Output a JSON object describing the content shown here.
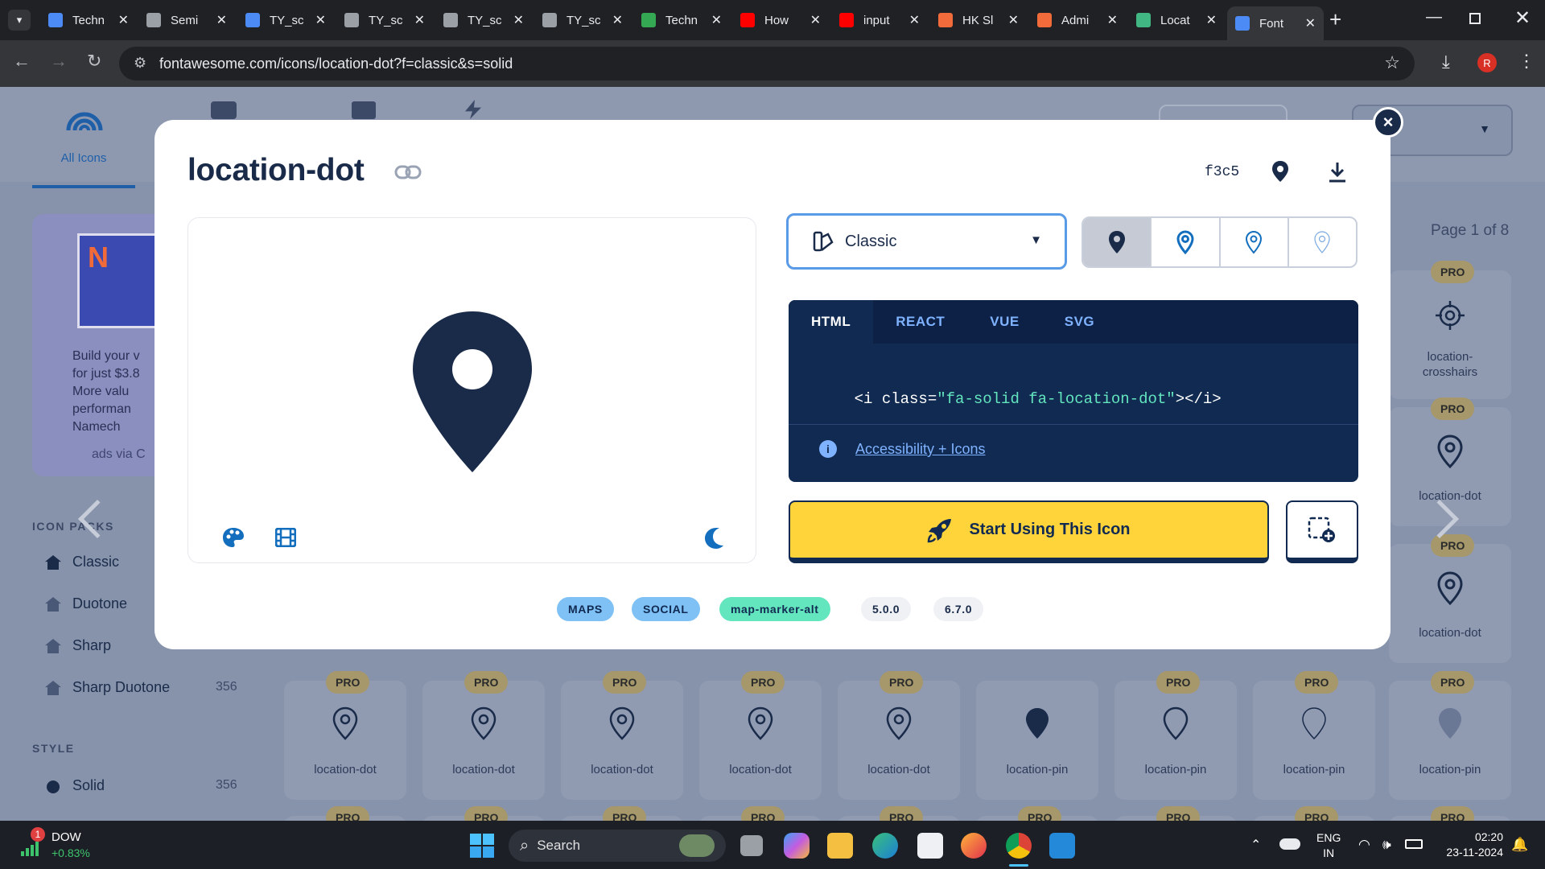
{
  "browser": {
    "tabs": [
      {
        "label": "Techn",
        "icon": "profile-icon",
        "color": "#4c8bf5"
      },
      {
        "label": "Semi",
        "icon": "globe-icon",
        "color": "#9aa0a6"
      },
      {
        "label": "TY_sc",
        "icon": "docs-icon",
        "color": "#4c8bf5"
      },
      {
        "label": "TY_sc",
        "icon": "globe-icon",
        "color": "#9aa0a6"
      },
      {
        "label": "TY_sc",
        "icon": "globe-icon",
        "color": "#9aa0a6"
      },
      {
        "label": "TY_sc",
        "icon": "globe-icon",
        "color": "#9aa0a6"
      },
      {
        "label": "Techn",
        "icon": "drive-icon",
        "color": "#34a853"
      },
      {
        "label": "How",
        "icon": "youtube-icon",
        "color": "#ff0000"
      },
      {
        "label": "input",
        "icon": "youtube-icon",
        "color": "#ff0000"
      },
      {
        "label": "HK Sl",
        "icon": "app-icon",
        "color": "#f26b3a"
      },
      {
        "label": "Admi",
        "icon": "app-icon",
        "color": "#f26b3a"
      },
      {
        "label": "Locat",
        "icon": "vue-icon",
        "color": "#41b883"
      },
      {
        "label": "Font",
        "icon": "flag-icon",
        "color": "#4c8bf5"
      }
    ],
    "url": "fontawesome.com/icons/location-dot?f=classic&s=solid",
    "profile_initial": "R"
  },
  "background": {
    "nav": [
      {
        "label": "All Icons"
      }
    ],
    "ad": {
      "lines": [
        "Build your v",
        "for just $3.8",
        "More valu",
        "performan",
        "Namech"
      ],
      "footer": "ads via C"
    },
    "icon_packs_heading": "ICON PACKS",
    "packs": [
      {
        "label": "Classic",
        "count": ""
      },
      {
        "label": "Duotone",
        "count": ""
      },
      {
        "label": "Sharp",
        "count": "356"
      },
      {
        "label": "Sharp Duotone",
        "count": "356"
      }
    ],
    "style_heading": "STYLE",
    "styles": [
      {
        "label": "Solid",
        "count": "356"
      }
    ],
    "page_indicator": "Page 1 of 8",
    "pro_label": "PRO",
    "right_column": [
      {
        "label": "location-\ncrosshairs"
      },
      {
        "label": "location-dot"
      },
      {
        "label": "location-dot"
      }
    ],
    "bottom_row": [
      "location-dot",
      "location-dot",
      "location-dot",
      "location-dot",
      "location-dot",
      "location-pin",
      "location-pin",
      "location-pin",
      "location-pin"
    ]
  },
  "modal": {
    "title": "location-dot",
    "unicode": "f3c5",
    "family_select": "Classic",
    "code_tabs": [
      "HTML",
      "REACT",
      "VUE",
      "SVG"
    ],
    "code_parts": {
      "open": "<i class=",
      "value": "\"fa-solid fa-location-dot\"",
      "close": "></i>"
    },
    "accessibility_link": "Accessibility + Icons",
    "start_button": "Start Using This Icon",
    "tags": [
      {
        "label": "MAPS",
        "bg": "#7fc1f5"
      },
      {
        "label": "SOCIAL",
        "bg": "#7fc1f5"
      },
      {
        "label": "map-marker-alt",
        "bg": "#63e6be"
      },
      {
        "label": "5.0.0",
        "bg": "#f0f1f4"
      },
      {
        "label": "6.7.0",
        "bg": "#f0f1f4"
      }
    ],
    "colors": {
      "navy": "#1a2b4a",
      "accent_blue": "#146ebe",
      "yellow": "#ffd43b"
    }
  },
  "taskbar": {
    "stock": {
      "name": "DOW",
      "change": "+0.83%",
      "badge": "1"
    },
    "search_placeholder": "Search",
    "lang": "ENG",
    "region": "IN",
    "time": "02:20",
    "date": "23-11-2024"
  }
}
